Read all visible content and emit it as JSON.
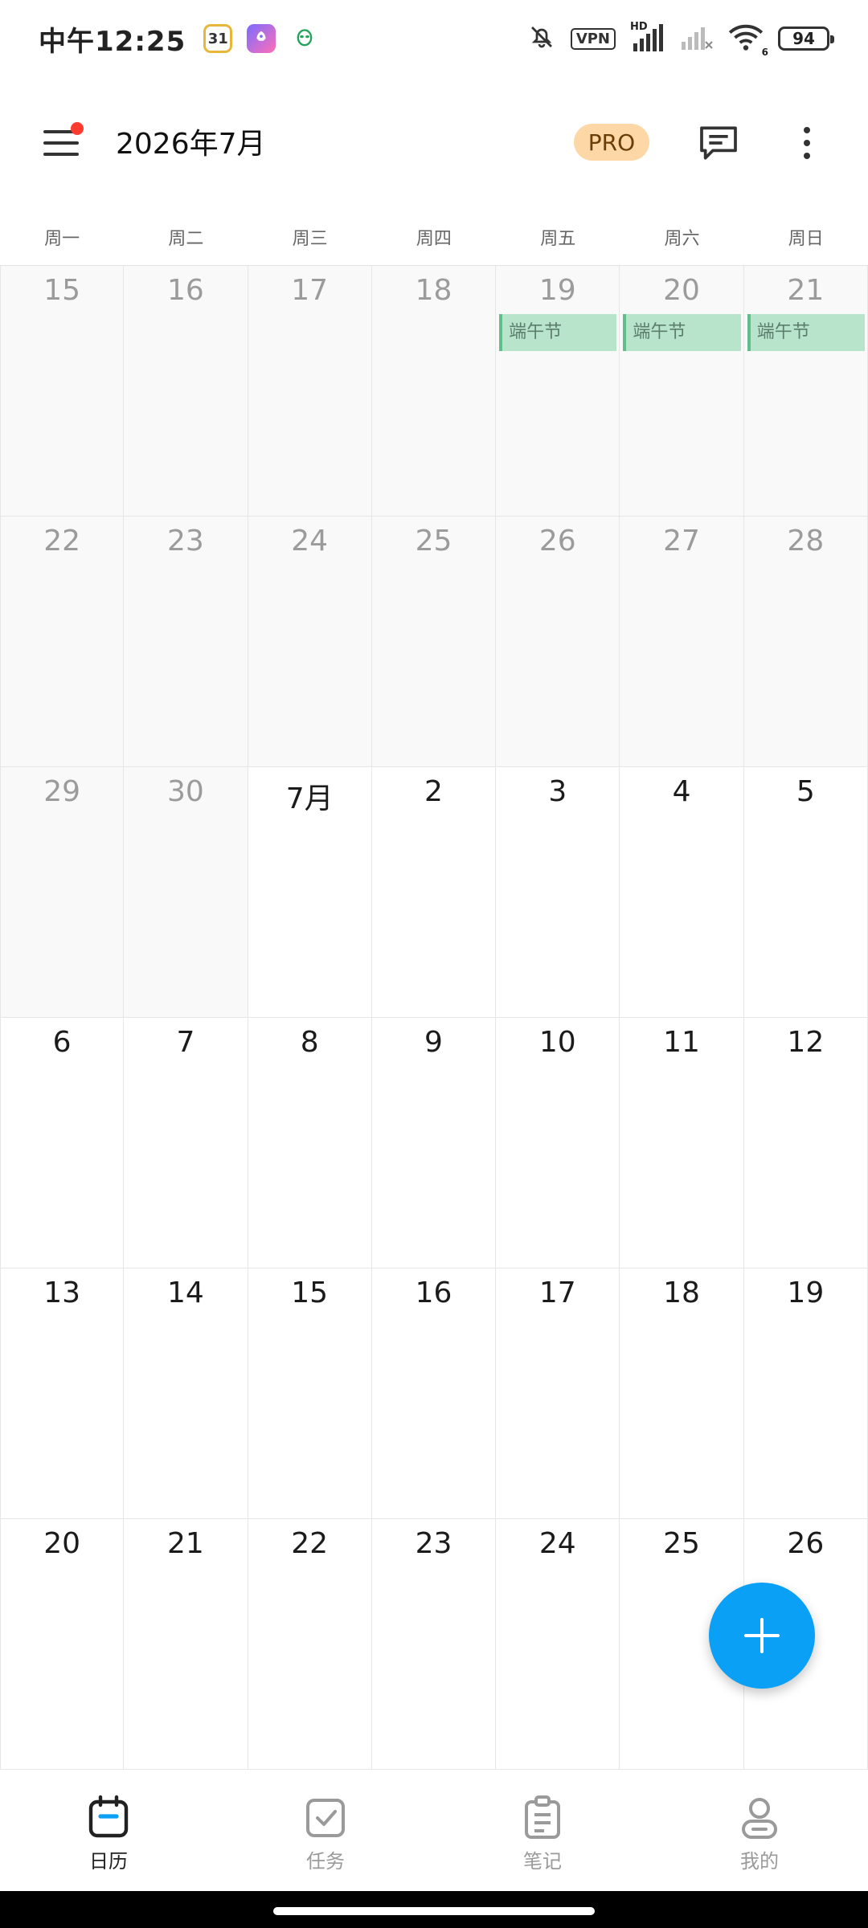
{
  "status_bar": {
    "time": "中午12:25",
    "apps": [
      {
        "name": "calendar-app-icon",
        "text": "31"
      },
      {
        "name": "rocket-app-icon",
        "text": ""
      },
      {
        "name": "alien-app-icon",
        "text": ""
      }
    ],
    "vpn": "VPN",
    "hd": "HD",
    "wifi_sub": "6",
    "battery": "94"
  },
  "header": {
    "title": "2026年7月",
    "pro_label": "PRO"
  },
  "weekdays": [
    "周一",
    "周二",
    "周三",
    "周四",
    "周五",
    "周六",
    "周日"
  ],
  "calendar": {
    "weeks": [
      [
        {
          "day": "15",
          "dim": true
        },
        {
          "day": "16",
          "dim": true
        },
        {
          "day": "17",
          "dim": true
        },
        {
          "day": "18",
          "dim": true
        },
        {
          "day": "19",
          "dim": true,
          "event": "端午节"
        },
        {
          "day": "20",
          "dim": true,
          "event": "端午节"
        },
        {
          "day": "21",
          "dim": true,
          "event": "端午节"
        }
      ],
      [
        {
          "day": "22",
          "dim": true
        },
        {
          "day": "23",
          "dim": true
        },
        {
          "day": "24",
          "dim": true
        },
        {
          "day": "25",
          "dim": true
        },
        {
          "day": "26",
          "dim": true
        },
        {
          "day": "27",
          "dim": true
        },
        {
          "day": "28",
          "dim": true
        }
      ],
      [
        {
          "day": "29",
          "dim": true
        },
        {
          "day": "30",
          "dim": true
        },
        {
          "day": "7月",
          "dim": false
        },
        {
          "day": "2",
          "dim": false
        },
        {
          "day": "3",
          "dim": false
        },
        {
          "day": "4",
          "dim": false
        },
        {
          "day": "5",
          "dim": false
        }
      ],
      [
        {
          "day": "6",
          "dim": false
        },
        {
          "day": "7",
          "dim": false
        },
        {
          "day": "8",
          "dim": false
        },
        {
          "day": "9",
          "dim": false
        },
        {
          "day": "10",
          "dim": false
        },
        {
          "day": "11",
          "dim": false
        },
        {
          "day": "12",
          "dim": false
        }
      ],
      [
        {
          "day": "13",
          "dim": false
        },
        {
          "day": "14",
          "dim": false
        },
        {
          "day": "15",
          "dim": false
        },
        {
          "day": "16",
          "dim": false
        },
        {
          "day": "17",
          "dim": false
        },
        {
          "day": "18",
          "dim": false
        },
        {
          "day": "19",
          "dim": false
        }
      ],
      [
        {
          "day": "20",
          "dim": false
        },
        {
          "day": "21",
          "dim": false
        },
        {
          "day": "22",
          "dim": false
        },
        {
          "day": "23",
          "dim": false
        },
        {
          "day": "24",
          "dim": false
        },
        {
          "day": "25",
          "dim": false
        },
        {
          "day": "26",
          "dim": false
        }
      ]
    ]
  },
  "fab": {
    "icon": "plus-icon"
  },
  "bottom_nav": {
    "items": [
      {
        "label": "日历",
        "icon": "calendar-icon",
        "active": true
      },
      {
        "label": "任务",
        "icon": "checkbox-icon",
        "active": false
      },
      {
        "label": "笔记",
        "icon": "clipboard-icon",
        "active": false
      },
      {
        "label": "我的",
        "icon": "profile-icon",
        "active": false
      }
    ]
  },
  "colors": {
    "accent": "#0aa0f6",
    "event_bg": "#b9e4cc",
    "event_border": "#5ebf8c",
    "pro_bg": "#fdd8a6",
    "notification_dot": "#ff3b30"
  }
}
